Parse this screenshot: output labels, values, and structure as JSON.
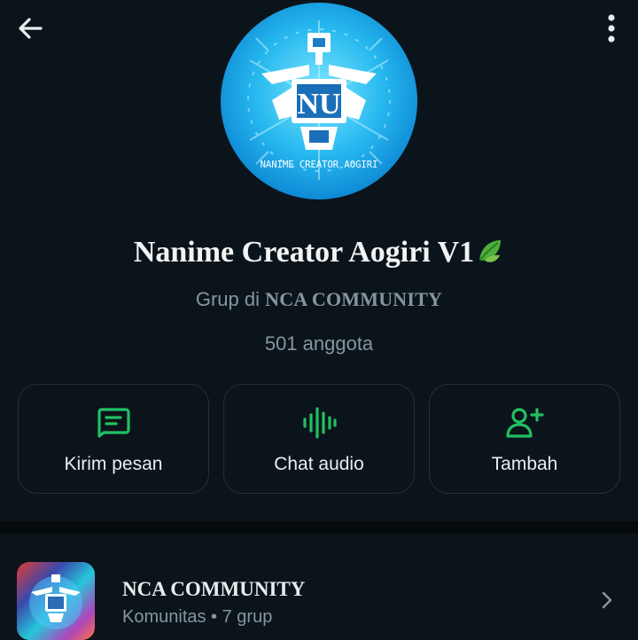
{
  "header": {
    "back_icon": "arrow-left-icon",
    "menu_icon": "more-vertical-icon"
  },
  "group": {
    "avatar_text": "NANIME CREATOR AOGIRI",
    "logo_letters": "NU",
    "title": "Nanime Creator Aogiri V1",
    "title_emoji": "leaf-emoji-icon",
    "subtitle_prefix": "Grup di",
    "subtitle_community": "NCA COMMUNITY",
    "members": "501 anggota"
  },
  "actions": [
    {
      "label": "Kirim pesan",
      "icon": "message-icon"
    },
    {
      "label": "Chat audio",
      "icon": "audio-wave-icon"
    },
    {
      "label": "Tambah",
      "icon": "add-person-icon"
    }
  ],
  "community": {
    "name": "NCA COMMUNITY",
    "meta": "Komunitas • 7 grup",
    "chevron_icon": "chevron-right-icon"
  },
  "colors": {
    "background": "#0b141a",
    "accent": "#21c063",
    "text_primary": "#e9edef",
    "text_secondary": "#8696a0",
    "card_border": "#233138"
  }
}
